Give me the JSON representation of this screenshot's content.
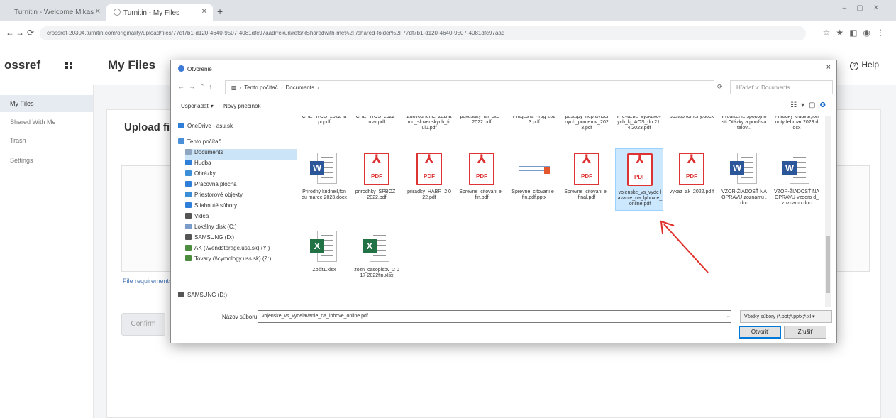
{
  "browser": {
    "tabs": [
      {
        "title": "Turnitin - Welcome Mikas"
      },
      {
        "title": "Turnitin - My Files"
      }
    ],
    "new_tab": "+",
    "url": "crossref-20304.turnitin.com/originality/upload/files/77df7b1-d120-4640-9507-4081dfc97aad/rekurl/refs/kSharedwith-me%2F/shared-folder%2F77df7b1-d120-4640-9507-4081dfc97aad"
  },
  "app": {
    "brand": "ossref",
    "page_title": "My Files",
    "help": "Help",
    "sidebar": [
      {
        "label": "My Files"
      },
      {
        "label": "Shared With Me"
      },
      {
        "label": "Trash"
      },
      {
        "label": "Settings"
      }
    ],
    "upload_title": "Upload file",
    "file_requirements": "File requirements",
    "confirm": "Confirm"
  },
  "dialog": {
    "title": "Otvorenie",
    "close": "×",
    "breadcrumb": [
      "Tento počítač",
      "Documents"
    ],
    "search_placeholder": "Hľadať v: Documents",
    "organize": "Usporiadať ▾",
    "new_folder": "Nový priečinok",
    "nav": [
      {
        "label": "OneDrive - asu.sk",
        "color": "#2f7fd8"
      },
      {
        "label": "Tento počítač",
        "color": "#4a90d9"
      },
      {
        "label": "Documents",
        "color": "#8fa6c1"
      },
      {
        "label": "Hudba",
        "color": "#2f7fd8"
      },
      {
        "label": "Obrázky",
        "color": "#3c8fd6"
      },
      {
        "label": "Pracovná plocha",
        "color": "#2f7fd8"
      },
      {
        "label": "Priestorové objekty",
        "color": "#3c8fd6"
      },
      {
        "label": "Stiahnuté súbory",
        "color": "#2f7fd8"
      },
      {
        "label": "Videá",
        "color": "#555555"
      },
      {
        "label": "Lokálny disk (C:)",
        "color": "#7a9cc9"
      },
      {
        "label": "SAMSUNG (D:)",
        "color": "#555555"
      },
      {
        "label": "AK (\\\\vendstorage.uss.sk) (Y:)",
        "color": "#4c8c3f"
      },
      {
        "label": "Tovary (\\\\cymology.uss.sk) (Z:)",
        "color": "#4c8c3f"
      },
      {
        "label": "SAMSUNG (D:)",
        "color": "#555555"
      }
    ],
    "top_row": [
      "CHE_WOS_2022_a pr.pdf",
      "CHE_WOS_2022_ mar.pdf",
      "Zdôvodnenie_zoznamu_slovenskych_tit ulu.pdf",
      "pokusaky_ail_cite _2022.pdf",
      "Prageš a. Prag 2023.pdf",
      "postupy_nepravidelnych_pomerov_202 3.pdf",
      "Prevazne_vyskakov ych_kj_AOS_do 21.4.2023.pdf",
      "postup tomeny.docx",
      "Predlženie spokojnosti Otázky a použivatelov...",
      "Priradky krdavší,fonnoty februar 2023.docx"
    ],
    "files": [
      {
        "name": "Prirodný kridneil,fondu maree 2023.docx",
        "type": "word"
      },
      {
        "name": "prirodhky_SPBOZ_ 2022.pdf",
        "type": "pdf"
      },
      {
        "name": "priradky_HABR_2 022.pdf",
        "type": "pdf"
      },
      {
        "name": "Sprevne_citovani e_fin.pdf",
        "type": "pdf"
      },
      {
        "name": "Sprevne_citovani e_fin.pdf.pptx",
        "type": "pptx"
      },
      {
        "name": "Sprevne_citovani e_final.pdf",
        "type": "pdf"
      },
      {
        "name": "vojenske_vs_vyde lavanie_na_lpbov e_online.pdf",
        "type": "pdf",
        "selected": true
      },
      {
        "name": "vykaz_ak_2022.pd f",
        "type": "pdf"
      },
      {
        "name": "VZOR-ŽIADOSŤ NA OPRAVU-zoznamu .doc",
        "type": "word"
      },
      {
        "name": "VZOR-ŽIADOSŤ NA OPRAVU-vzdoro d_zoznamu.doc",
        "type": "word"
      },
      {
        "name": "Zošit1.xlsx",
        "type": "excel"
      },
      {
        "name": "zozn_casopisov_2 017-2022fin.xlsx",
        "type": "excel"
      }
    ],
    "file_name_label": "Názov súboru:",
    "file_name_value": "vojenske_vs_vydelavanie_na_lpbove_online.pdf",
    "filter": "Všetky súbory (*.ppt;*.pptx;*.xl ▾",
    "open": "Otvoriť",
    "cancel": "Zrušiť"
  }
}
